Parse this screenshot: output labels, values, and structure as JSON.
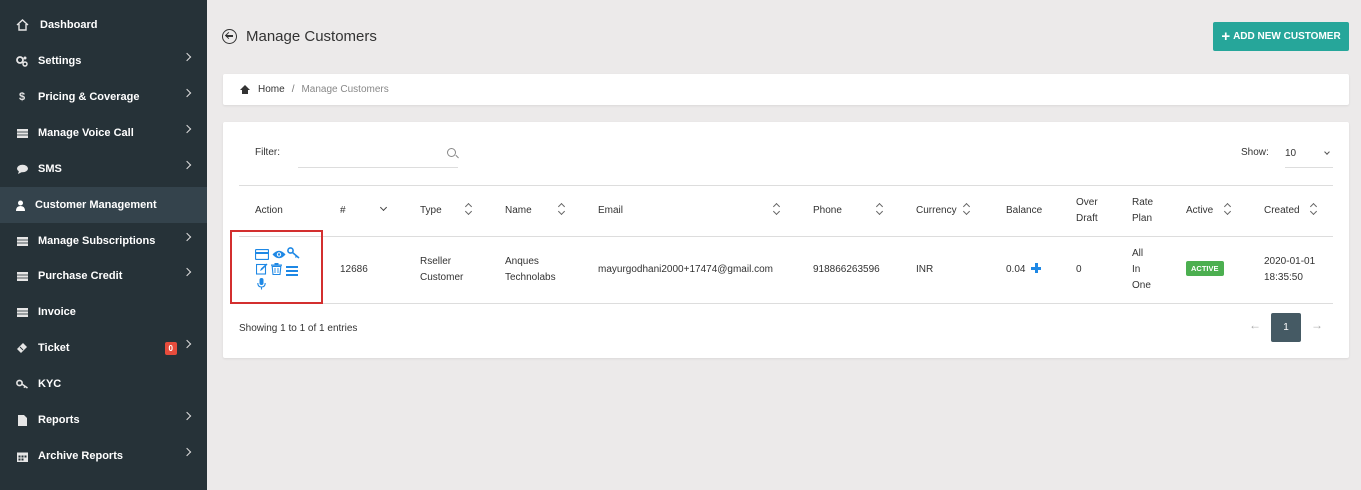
{
  "sidebar": {
    "items": [
      {
        "label": "Dashboard",
        "icon": "home-icon"
      },
      {
        "label": "Settings",
        "icon": "cogs-icon"
      },
      {
        "label": "Pricing & Coverage",
        "icon": "dollar-icon"
      },
      {
        "label": "Manage Voice Call",
        "icon": "list-icon"
      },
      {
        "label": "SMS",
        "icon": "comment-icon"
      },
      {
        "label": "Customer Management",
        "icon": "user-icon"
      },
      {
        "label": "Manage Subscriptions",
        "icon": "list-icon"
      },
      {
        "label": "Purchase Credit",
        "icon": "list-icon"
      },
      {
        "label": "Invoice",
        "icon": "list-icon"
      },
      {
        "label": "Ticket",
        "icon": "ticket-icon",
        "badge": "0"
      },
      {
        "label": "KYC",
        "icon": "key-icon"
      },
      {
        "label": "Reports",
        "icon": "file-icon"
      },
      {
        "label": "Archive Reports",
        "icon": "calendar-icon"
      }
    ],
    "active": "Customer Management"
  },
  "header": {
    "title": "Manage Customers",
    "add_button": "ADD NEW CUSTOMER"
  },
  "breadcrumb": {
    "home": "Home",
    "separator": "/",
    "current": "Manage Customers"
  },
  "table_controls": {
    "filter_label": "Filter:",
    "filter_value": "",
    "show_label": "Show:",
    "show_value": "10"
  },
  "table": {
    "headers": {
      "action": "Action",
      "id": "#",
      "type": "Type",
      "name": "Name",
      "email": "Email",
      "phone": "Phone",
      "currency": "Currency",
      "balance": "Balance",
      "overdraft_1": "Over",
      "overdraft_2": "Draft",
      "rateplan_1": "Rate",
      "rateplan_2": "Plan",
      "active": "Active",
      "created": "Created"
    },
    "rows": [
      {
        "id": "12686",
        "type_1": "Rseller",
        "type_2": "Customer",
        "name_1": "Anques",
        "name_2": "Technolabs",
        "email": "mayurgodhani2000+17474@gmail.com",
        "phone": "918866263596",
        "currency": "INR",
        "balance": "0.04",
        "overdraft": "0",
        "rateplan_1": "All",
        "rateplan_2": "In",
        "rateplan_3": "One",
        "active": "ACTIVE",
        "created_1": "2020-01-01",
        "created_2": "18:35:50"
      }
    ]
  },
  "footer": {
    "showing": "Showing 1 to 1 of 1 entries",
    "prev": "←",
    "page": "1",
    "next": "→"
  },
  "colors": {
    "sidebar_bg": "#263238",
    "accent": "#26a69a",
    "badge_active": "#4caf50",
    "action_icon": "#1e88e5",
    "highlight_box": "#d32f2f"
  }
}
